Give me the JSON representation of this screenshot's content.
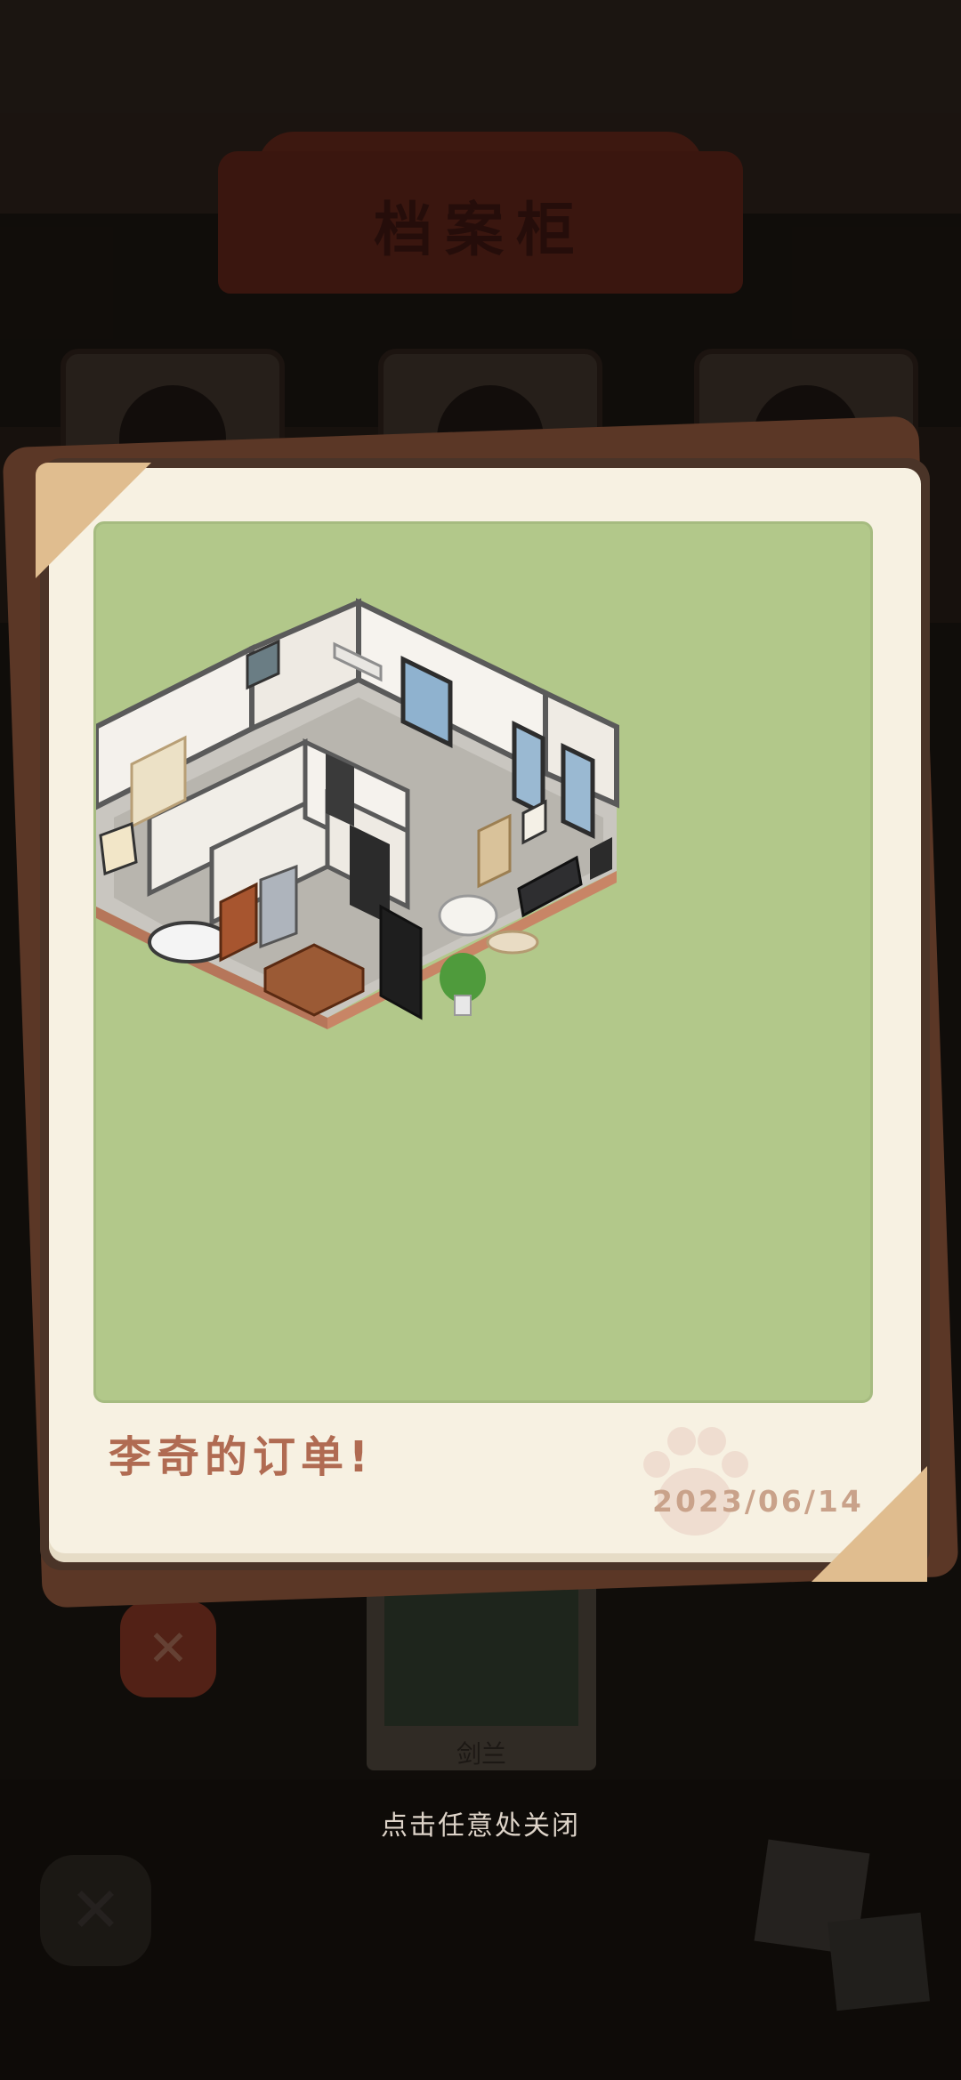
{
  "background": {
    "title": "档案柜",
    "bottom_card_name": "剑兰"
  },
  "popup": {
    "caption": "李奇的订单!",
    "date": "2023/06/14",
    "photo_subject": "isometric-room-layout"
  },
  "hint": "点击任意处关闭",
  "colors": {
    "photo_bg": "#b2c88a",
    "paper": "#f7f1e2",
    "caption": "#b06b52",
    "corner": "#e0bd8f"
  }
}
